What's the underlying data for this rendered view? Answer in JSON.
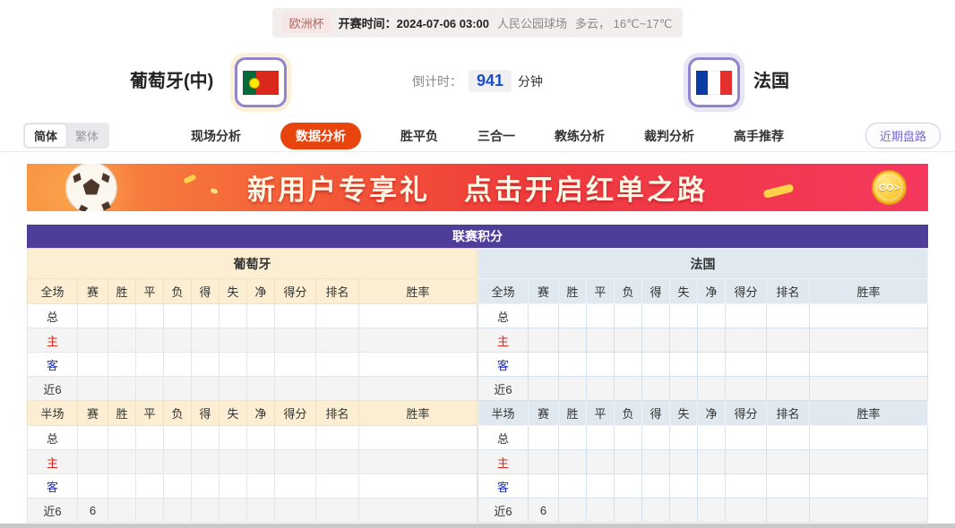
{
  "topbar": {
    "league": "欧洲杯",
    "kickoff_label": "开赛时间：",
    "kickoff_time": "2024-07-06 03:00",
    "venue": "人民公园球场",
    "weather": "多云， 16℃~17℃"
  },
  "match": {
    "home_team": "葡萄牙(中)",
    "away_team": "法国",
    "countdown_label": "倒计时：",
    "countdown_value": "941",
    "countdown_unit": "分钟"
  },
  "nav": {
    "lang_simplified": "简体",
    "lang_traditional": "繁体",
    "tabs": [
      {
        "label": "现场分析",
        "active": false
      },
      {
        "label": "数据分析",
        "active": true
      },
      {
        "label": "胜平负",
        "active": false
      },
      {
        "label": "三合一",
        "active": false
      },
      {
        "label": "教练分析",
        "active": false
      },
      {
        "label": "裁判分析",
        "active": false
      },
      {
        "label": "高手推荐",
        "active": false
      }
    ],
    "recent_button": "近期盘路"
  },
  "banner": {
    "text_left": "新用户专享礼",
    "text_right": "点击开启红单之路",
    "go_label": "GO>"
  },
  "colors": {
    "accent_purple": "#4e3e99",
    "active_tab": "#e8440e",
    "home_header_bg": "#fbeed3",
    "away_header_bg": "#dfe9ef",
    "home_label_red": "#e0251b",
    "away_label_blue": "#1f2fd0"
  },
  "table": {
    "title": "联赛积分",
    "halves": [
      {
        "team": "葡萄牙",
        "theme": "home"
      },
      {
        "team": "法国",
        "theme": "away"
      }
    ],
    "sections": [
      {
        "scope_label": "全场",
        "columns": [
          "赛",
          "胜",
          "平",
          "负",
          "得",
          "失",
          "净",
          "得分",
          "排名",
          "胜率"
        ],
        "rows": [
          {
            "label": "总",
            "type": "total",
            "cells": [
              "",
              "",
              "",
              "",
              "",
              "",
              "",
              "",
              "",
              ""
            ]
          },
          {
            "label": "主",
            "type": "home",
            "cells": [
              "",
              "",
              "",
              "",
              "",
              "",
              "",
              "",
              "",
              ""
            ]
          },
          {
            "label": "客",
            "type": "away",
            "cells": [
              "",
              "",
              "",
              "",
              "",
              "",
              "",
              "",
              "",
              ""
            ]
          },
          {
            "label": "近6",
            "type": "recent",
            "cells": [
              "",
              "",
              "",
              "",
              "",
              "",
              "",
              "",
              "",
              ""
            ]
          }
        ]
      },
      {
        "scope_label": "半场",
        "columns": [
          "赛",
          "胜",
          "平",
          "负",
          "得",
          "失",
          "净",
          "得分",
          "排名",
          "胜率"
        ],
        "rows": [
          {
            "label": "总",
            "type": "total",
            "cells": [
              "",
              "",
              "",
              "",
              "",
              "",
              "",
              "",
              "",
              ""
            ]
          },
          {
            "label": "主",
            "type": "home",
            "cells": [
              "",
              "",
              "",
              "",
              "",
              "",
              "",
              "",
              "",
              ""
            ]
          },
          {
            "label": "客",
            "type": "away",
            "cells": [
              "",
              "",
              "",
              "",
              "",
              "",
              "",
              "",
              "",
              ""
            ]
          },
          {
            "label": "近6",
            "type": "recent",
            "cells": [
              "6",
              "",
              "",
              "",
              "",
              "",
              "",
              "",
              "",
              ""
            ]
          }
        ]
      }
    ]
  }
}
